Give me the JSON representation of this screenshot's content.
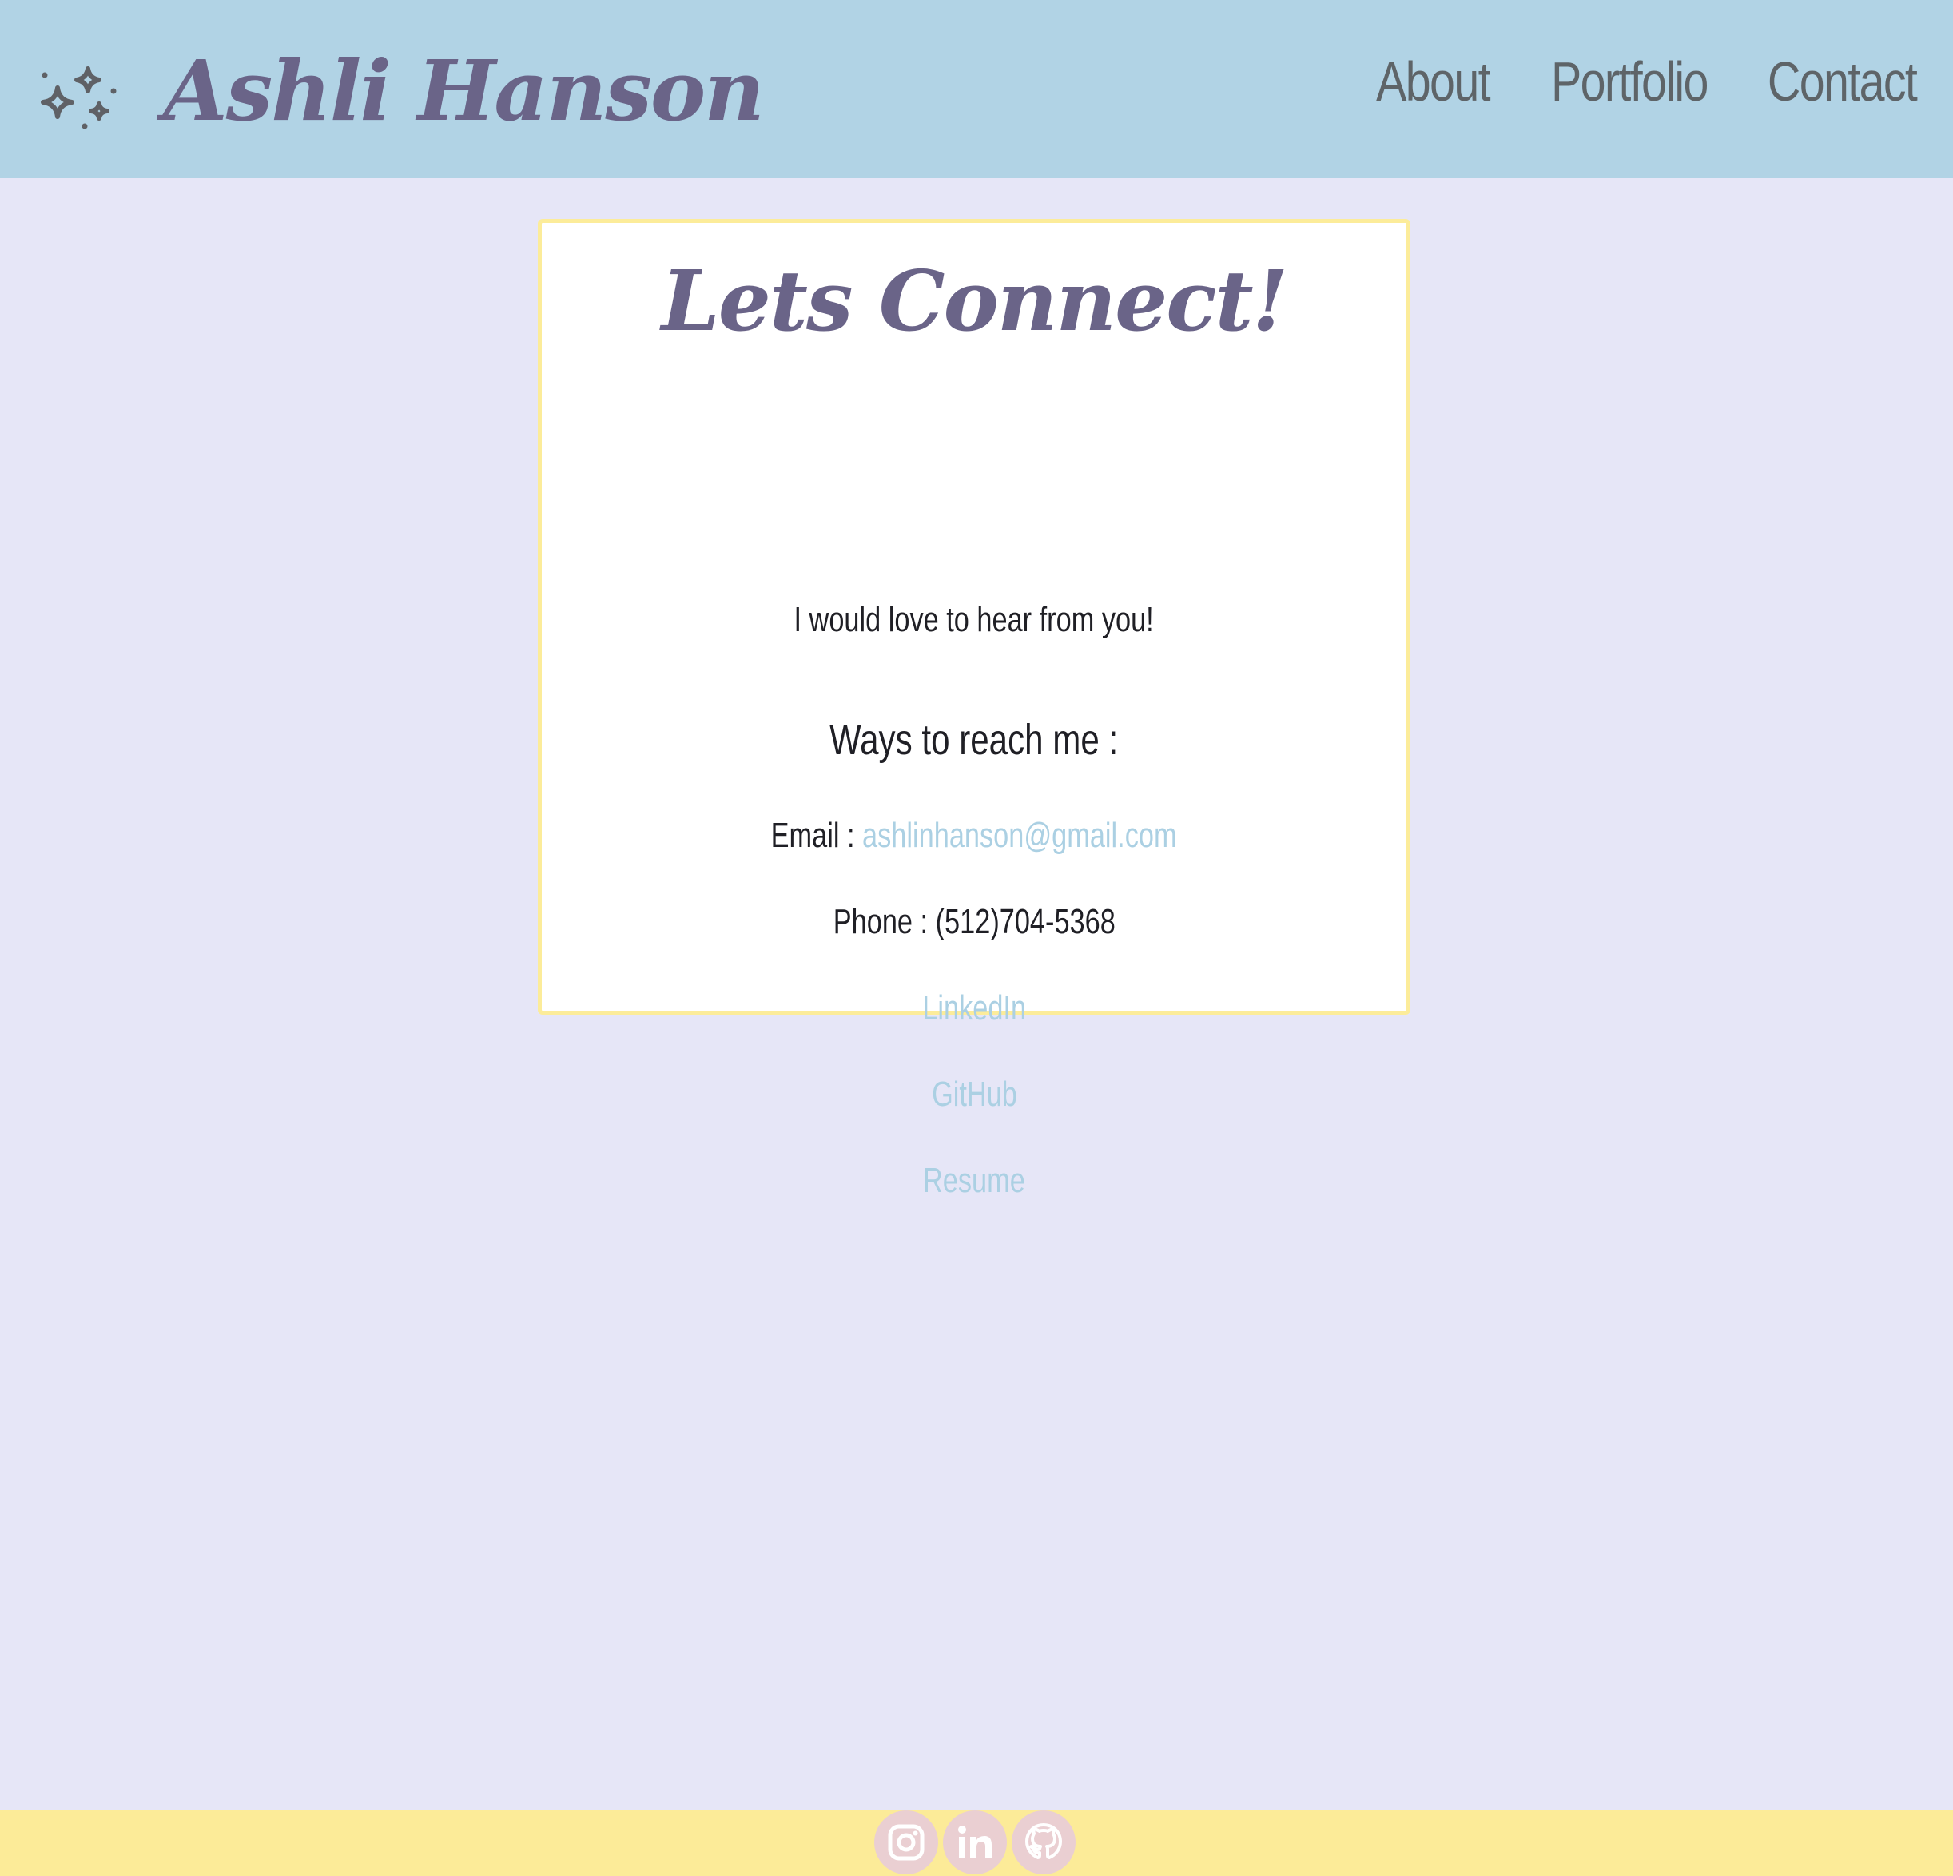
{
  "header": {
    "brand_name": "Ashli Hanson",
    "logo_icon": "sparkles-icon",
    "nav": [
      {
        "label": "About"
      },
      {
        "label": "Portfolio"
      },
      {
        "label": "Contact"
      }
    ]
  },
  "card": {
    "title": "Lets Connect!",
    "subtitle": "I would love to hear from you!",
    "reach_heading": "Ways to reach me :",
    "email_label": "Email : ",
    "email_value": "ashlinhanson@gmail.com",
    "phone_label": "Phone : ",
    "phone_value": "(512)704-5368",
    "links": {
      "linkedin": "LinkedIn",
      "github": "GitHub",
      "resume": "Resume"
    }
  },
  "footer": {
    "social": [
      {
        "icon": "instagram-icon"
      },
      {
        "icon": "linkedin-icon"
      },
      {
        "icon": "github-icon"
      }
    ]
  },
  "colors": {
    "header_bg": "#b1d3e5",
    "page_bg": "#e6e6f7",
    "footer_bg": "#fceb98",
    "accent_text": "#6a6488",
    "link": "#abd0e3",
    "card_border": "#fcec9a",
    "social_bg": "#eacfd2"
  }
}
